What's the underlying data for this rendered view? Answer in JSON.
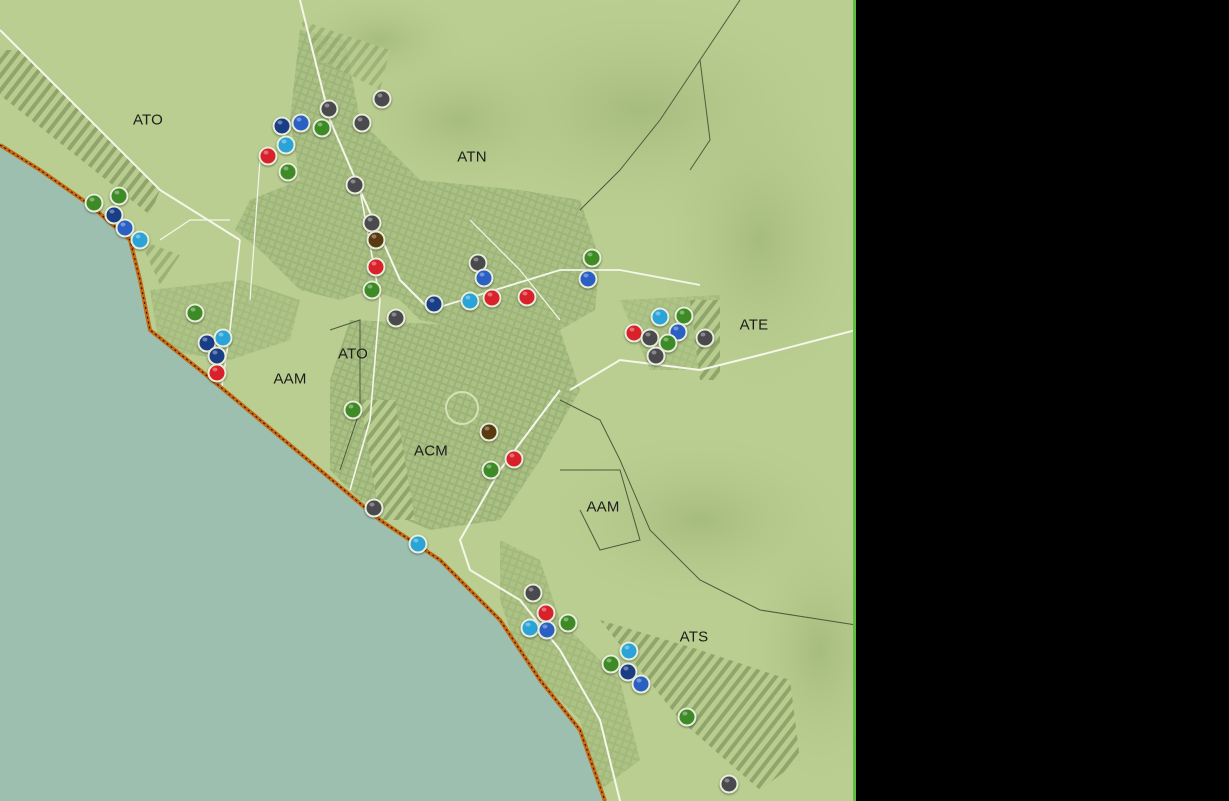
{
  "map": {
    "zone_labels": [
      {
        "id": "ato-north",
        "text": "ATO"
      },
      {
        "id": "atn",
        "text": "ATN"
      },
      {
        "id": "ate",
        "text": "ATE"
      },
      {
        "id": "aam-west",
        "text": "AAM"
      },
      {
        "id": "ato-center",
        "text": "ATO"
      },
      {
        "id": "acm",
        "text": "ACM"
      },
      {
        "id": "aam-east",
        "text": "AAM"
      },
      {
        "id": "ats",
        "text": "ATS"
      }
    ],
    "marker_colors": {
      "green": "#3e8a26",
      "navy": "#1a3e86",
      "blue": "#2a5fc4",
      "cyan": "#2aa3d8",
      "red": "#d8212a",
      "gray": "#4a4a4e",
      "brown": "#5a3a10"
    },
    "markers": [
      {
        "zone": "ATO",
        "color": "green"
      },
      {
        "zone": "ATO",
        "color": "green"
      },
      {
        "zone": "ATO",
        "color": "navy"
      },
      {
        "zone": "ATO",
        "color": "blue"
      },
      {
        "zone": "ATO",
        "color": "cyan"
      },
      {
        "zone": "ATN",
        "color": "navy"
      },
      {
        "zone": "ATN",
        "color": "blue"
      },
      {
        "zone": "ATN",
        "color": "green"
      },
      {
        "zone": "ATN",
        "color": "gray"
      },
      {
        "zone": "ATN",
        "color": "gray"
      },
      {
        "zone": "ATN",
        "color": "gray"
      },
      {
        "zone": "ATN",
        "color": "cyan"
      },
      {
        "zone": "ATN",
        "color": "red"
      },
      {
        "zone": "ATN",
        "color": "green"
      },
      {
        "zone": "ATN",
        "color": "gray"
      },
      {
        "zone": "ATN",
        "color": "gray"
      },
      {
        "zone": "ATN",
        "color": "brown"
      },
      {
        "zone": "ATN",
        "color": "red"
      },
      {
        "zone": "ATN",
        "color": "green"
      },
      {
        "zone": "ATN",
        "color": "gray"
      },
      {
        "zone": "ATN",
        "color": "gray"
      },
      {
        "zone": "ATN",
        "color": "blue"
      },
      {
        "zone": "ATN",
        "color": "navy"
      },
      {
        "zone": "ATN",
        "color": "cyan"
      },
      {
        "zone": "ATN",
        "color": "red"
      },
      {
        "zone": "ATN",
        "color": "red"
      },
      {
        "zone": "ATN",
        "color": "green"
      },
      {
        "zone": "ATN",
        "color": "blue"
      },
      {
        "zone": "ATE",
        "color": "cyan"
      },
      {
        "zone": "ATE",
        "color": "green"
      },
      {
        "zone": "ATE",
        "color": "red"
      },
      {
        "zone": "ATE",
        "color": "gray"
      },
      {
        "zone": "ATE",
        "color": "blue"
      },
      {
        "zone": "ATE",
        "color": "green"
      },
      {
        "zone": "ATE",
        "color": "gray"
      },
      {
        "zone": "ATE",
        "color": "gray"
      },
      {
        "zone": "AAM",
        "color": "green"
      },
      {
        "zone": "AAM",
        "color": "navy"
      },
      {
        "zone": "AAM",
        "color": "cyan"
      },
      {
        "zone": "AAM",
        "color": "navy"
      },
      {
        "zone": "AAM",
        "color": "red"
      },
      {
        "zone": "ATO",
        "color": "green"
      },
      {
        "zone": "ACM",
        "color": "brown"
      },
      {
        "zone": "ACM",
        "color": "red"
      },
      {
        "zone": "ACM",
        "color": "green"
      },
      {
        "zone": "ACM",
        "color": "gray"
      },
      {
        "zone": "ACM",
        "color": "cyan"
      },
      {
        "zone": "ATS",
        "color": "gray"
      },
      {
        "zone": "ATS",
        "color": "red"
      },
      {
        "zone": "ATS",
        "color": "cyan"
      },
      {
        "zone": "ATS",
        "color": "blue"
      },
      {
        "zone": "ATS",
        "color": "green"
      },
      {
        "zone": "ATS",
        "color": "cyan"
      },
      {
        "zone": "ATS",
        "color": "green"
      },
      {
        "zone": "ATS",
        "color": "navy"
      },
      {
        "zone": "ATS",
        "color": "blue"
      },
      {
        "zone": "ATS",
        "color": "green"
      },
      {
        "zone": "ATS",
        "color": "gray"
      }
    ]
  }
}
